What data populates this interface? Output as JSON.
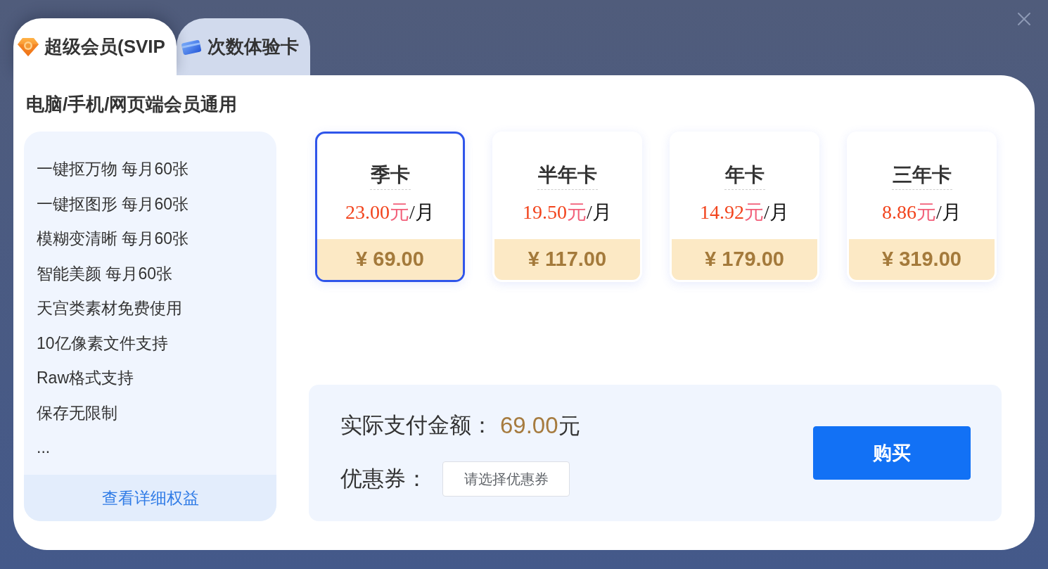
{
  "tabs": [
    {
      "kind": "svip",
      "label": "超级会员(SVIP",
      "selected": true
    },
    {
      "kind": "trial",
      "label": "次数体验卡",
      "selected": false
    }
  ],
  "heading": "电脑/手机/网页端会员通用",
  "benefits": {
    "items": [
      "一键抠万物 每月60张",
      "一键抠图形 每月60张",
      "模糊变清晰 每月60张",
      "智能美颜 每月60张",
      "天宫类素材免费使用",
      "10亿像素文件支持",
      "Raw格式支持",
      "保存无限制",
      "..."
    ],
    "details_link": "查看详细权益"
  },
  "plans": [
    {
      "name": "季卡",
      "monthly": "23.00",
      "monthly_unit": "元",
      "period": "/月",
      "total": "¥ 69.00",
      "selected": true
    },
    {
      "name": "半年卡",
      "monthly": "19.50",
      "monthly_unit": "元",
      "period": "/月",
      "total": "¥ 117.00",
      "selected": false
    },
    {
      "name": "年卡",
      "monthly": "14.92",
      "monthly_unit": "元",
      "period": "/月",
      "total": "¥ 179.00",
      "selected": false
    },
    {
      "name": "三年卡",
      "monthly": "8.86",
      "monthly_unit": "元",
      "period": "/月",
      "total": "¥ 319.00",
      "selected": false
    }
  ],
  "payment": {
    "amount_label": "实际支付金额：",
    "amount": "69.00",
    "amount_unit": "元",
    "coupon_label": "优惠券：",
    "coupon_button": "请选择优惠券",
    "buy_button": "购买"
  }
}
